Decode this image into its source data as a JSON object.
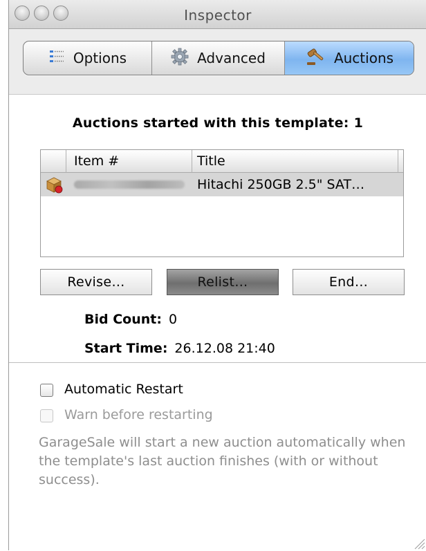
{
  "window": {
    "title": "Inspector"
  },
  "tabs": [
    {
      "label": "Options",
      "icon": "options-list-icon"
    },
    {
      "label": "Advanced",
      "icon": "gear-icon"
    },
    {
      "label": "Auctions",
      "icon": "gavel-icon",
      "selected": true
    }
  ],
  "auctions": {
    "heading": "Auctions started with this template: 1",
    "table": {
      "columns": [
        "Item #",
        "Title"
      ],
      "rows": [
        {
          "item": "",
          "title": "Hitachi 250GB 2.5\" SAT…",
          "status_icon": "auction-box-icon"
        }
      ]
    },
    "buttons": {
      "revise": "Revise…",
      "relist": "Relist…",
      "end": "End…"
    },
    "bid_count": {
      "label": "Bid Count:",
      "value": "0"
    },
    "start_time": {
      "label": "Start Time:",
      "value": "26.12.08 21:40"
    }
  },
  "restart": {
    "automatic_restart": {
      "label": "Automatic Restart",
      "checked": false,
      "enabled": true
    },
    "warn_before": {
      "label": "Warn before restarting",
      "checked": false,
      "enabled": false
    },
    "description": "GarageSale will start a new auction automatically when the template's last auction finishes (with or without success)."
  },
  "colors": {
    "selected_tab": "#8fc0f3",
    "disabled_text": "#9a9a9a"
  }
}
